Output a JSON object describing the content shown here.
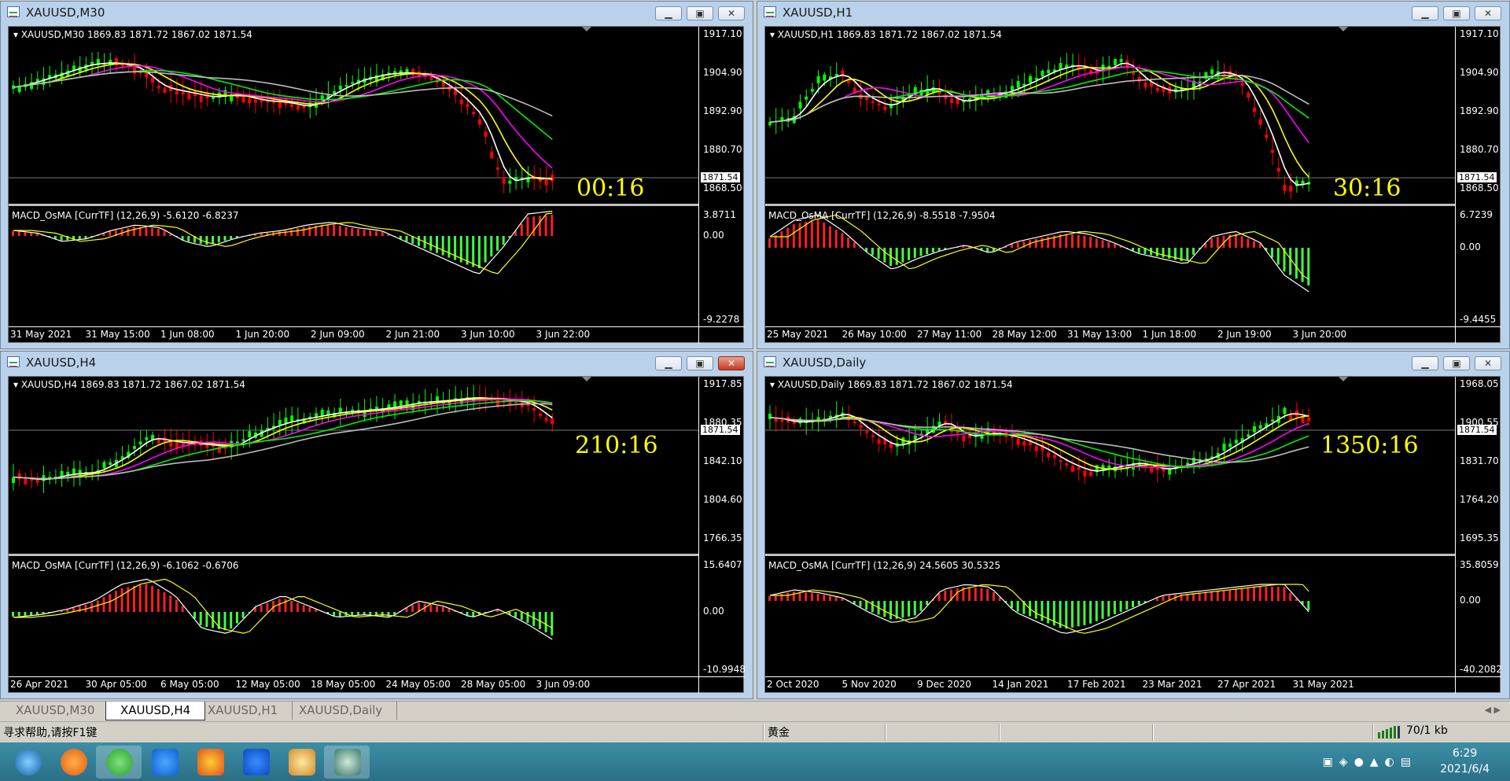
{
  "windows": [
    {
      "id": "m30",
      "title": "XAUUSD,M30",
      "header": "XAUUSD,M30  1869.83 1871.72 1867.02 1871.54",
      "prices": [
        "1917.10",
        "1904.90",
        "1892.90",
        "1880.70",
        "1868.50"
      ],
      "current": "1871.54",
      "timer": "00:16",
      "macd": "MACD_OsMA [CurrTF] (12,26,9) -5.6120 -6.8237",
      "macd_levels": [
        "3.8711",
        "0.00",
        "-9.2278"
      ],
      "times": [
        "31 May 2021",
        "31 May 15:00",
        "1 Jun 08:00",
        "1 Jun 20:00",
        "2 Jun 09:00",
        "2 Jun 21:00",
        "3 Jun 10:00",
        "3 Jun 22:00"
      ],
      "close_red": false
    },
    {
      "id": "h1",
      "title": "XAUUSD,H1",
      "header": "XAUUSD,H1  1869.83 1871.72 1867.02 1871.54",
      "prices": [
        "1917.10",
        "1904.90",
        "1892.90",
        "1880.70",
        "1868.50"
      ],
      "current": "1871.54",
      "timer": "30:16",
      "macd": "MACD_OsMA [CurrTF] (12,26,9) -8.5518 -7.9504",
      "macd_levels": [
        "6.7239",
        "0.00",
        "-9.4455"
      ],
      "times": [
        "25 May 2021",
        "26 May 10:00",
        "27 May 11:00",
        "28 May 12:00",
        "31 May 13:00",
        "1 Jun 18:00",
        "2 Jun 19:00",
        "3 Jun 20:00"
      ],
      "close_red": false
    },
    {
      "id": "h4",
      "title": "XAUUSD,H4",
      "header": "XAUUSD,H4  1869.83 1871.72 1867.02 1871.54",
      "prices": [
        "1917.85",
        "1880.35",
        "1842.10",
        "1804.60",
        "1766.35"
      ],
      "current": "1871.54",
      "timer": "210:16",
      "macd": "MACD_OsMA [CurrTF] (12,26,9) -6.1062 -0.6706",
      "macd_levels": [
        "15.6407",
        "0.00",
        "-10.9948"
      ],
      "times": [
        "26 Apr 2021",
        "30 Apr 05:00",
        "6 May 05:00",
        "12 May 05:00",
        "18 May 05:00",
        "24 May 05:00",
        "28 May 05:00",
        "3 Jun 09:00"
      ],
      "close_red": true
    },
    {
      "id": "d1",
      "title": "XAUUSD,Daily",
      "header": "XAUUSD,Daily  1869.83 1871.72 1867.02 1871.54",
      "prices": [
        "1968.05",
        "1900.55",
        "1831.70",
        "1764.20",
        "1695.35"
      ],
      "current": "1871.54",
      "timer": "1350:16",
      "macd": "MACD_OsMA [CurrTF] (12,26,9) 24.5605 30.5325",
      "macd_levels": [
        "35.8059",
        "0.00",
        "-40.2082"
      ],
      "times": [
        "2 Oct 2020",
        "5 Nov 2020",
        "9 Dec 2020",
        "14 Jan 2021",
        "17 Feb 2021",
        "23 Mar 2021",
        "27 Apr 2021",
        "31 May 2021"
      ],
      "close_red": false
    }
  ],
  "tabs": [
    "XAUUSD,M30",
    "XAUUSD,H4",
    "XAUUSD,H1",
    "XAUUSD,Daily"
  ],
  "active_tab": 1,
  "status": {
    "help": "寻求帮助,请按F1键",
    "profile": "黄金",
    "traffic": "70/1 kb"
  },
  "clock": {
    "time": "6:29",
    "date": "2021/6/4"
  },
  "taskbar_icons": [
    "start-orb-icon",
    "browser-icon",
    "wechat-icon",
    "pen-icon",
    "firefox-icon",
    "feishu-icon",
    "paint-icon",
    "metatrader-icon"
  ]
}
